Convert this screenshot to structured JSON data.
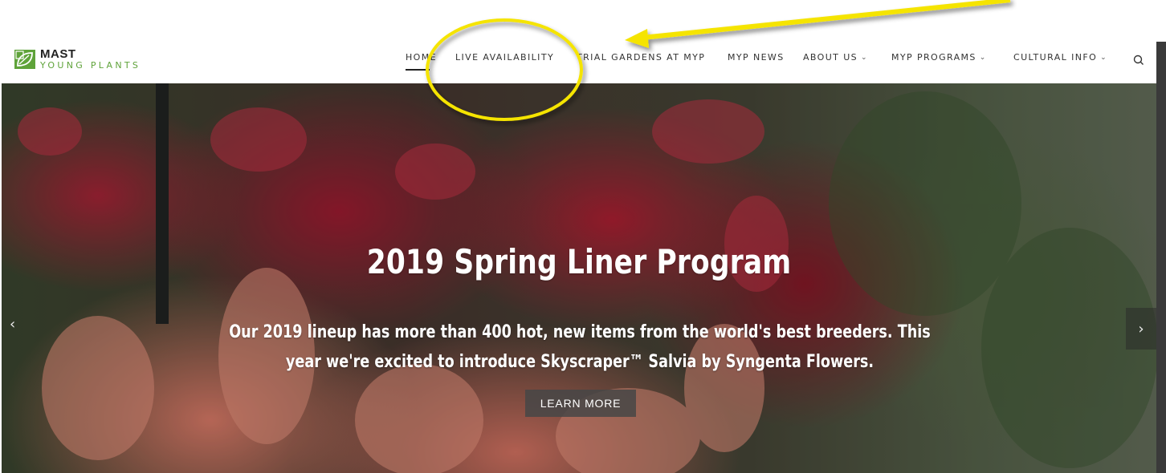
{
  "logo": {
    "top": "MAST",
    "bottom": "YOUNG PLANTS",
    "accent_color": "#5fa33a"
  },
  "nav": [
    {
      "label": "HOME",
      "dropdown": false,
      "active": true
    },
    {
      "label": "LIVE AVAILABILITY",
      "dropdown": false
    },
    {
      "label": "TRIAL GARDENS AT MYP",
      "dropdown": false
    },
    {
      "label": "MYP NEWS",
      "dropdown": false
    },
    {
      "label": "ABOUT US",
      "dropdown": true
    },
    {
      "label": "MYP PROGRAMS",
      "dropdown": true
    },
    {
      "label": "CULTURAL INFO",
      "dropdown": true
    }
  ],
  "nav_chevron": "⌄",
  "search_icon": "search-icon",
  "hero": {
    "title": "2019 Spring Liner Program",
    "subtitle": "Our 2019 lineup has more than 400 hot, new items from the world's best breeders. This year we're excited to introduce Skyscraper™ Salvia by Syngenta Flowers.",
    "button": "LEARN MORE",
    "prev": "‹",
    "next": "›"
  },
  "annotation_color": "#f5e400"
}
